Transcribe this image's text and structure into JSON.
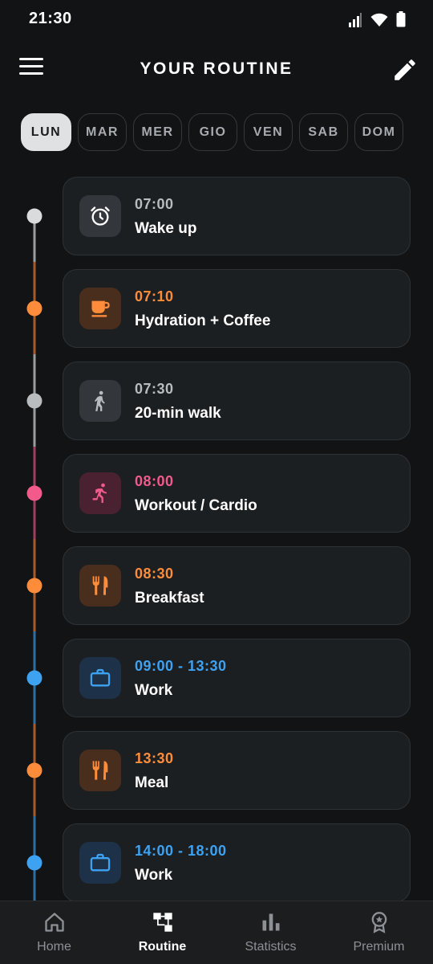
{
  "status_bar": {
    "time": "21:30"
  },
  "header": {
    "title": "YOUR ROUTINE"
  },
  "days": [
    {
      "label": "LUN",
      "active": true
    },
    {
      "label": "MAR"
    },
    {
      "label": "MER"
    },
    {
      "label": "GIO"
    },
    {
      "label": "VEN"
    },
    {
      "label": "SAB"
    },
    {
      "label": "DOM"
    }
  ],
  "colors": {
    "grey": "#b9bcbf",
    "orange": "#ff8c3a",
    "pink": "#f25a8c",
    "blue": "#3ea2f2"
  },
  "routine": [
    {
      "time": "07:00",
      "title": "Wake up",
      "icon": "alarm-clock-icon",
      "color": "grey"
    },
    {
      "time": "07:10",
      "title": "Hydration + Coffee",
      "icon": "coffee-cup-icon",
      "color": "orange"
    },
    {
      "time": "07:30",
      "title": "20-min walk",
      "icon": "walking-person-icon",
      "color": "grey"
    },
    {
      "time": "08:00",
      "title": "Workout / Cardio",
      "icon": "running-person-icon",
      "color": "pink"
    },
    {
      "time": "08:30",
      "title": "Breakfast",
      "icon": "fork-knife-icon",
      "color": "orange"
    },
    {
      "time": "09:00 - 13:30",
      "title": "Work",
      "icon": "briefcase-icon",
      "color": "blue"
    },
    {
      "time": "13:30",
      "title": "Meal",
      "icon": "fork-knife-icon",
      "color": "orange"
    },
    {
      "time": "14:00 - 18:00",
      "title": "Work",
      "icon": "briefcase-icon",
      "color": "blue"
    }
  ],
  "nav": [
    {
      "label": "Home",
      "icon": "home-icon"
    },
    {
      "label": "Routine",
      "icon": "routine-icon",
      "active": true
    },
    {
      "label": "Statistics",
      "icon": "bar-chart-icon"
    },
    {
      "label": "Premium",
      "icon": "award-medal-icon"
    }
  ]
}
